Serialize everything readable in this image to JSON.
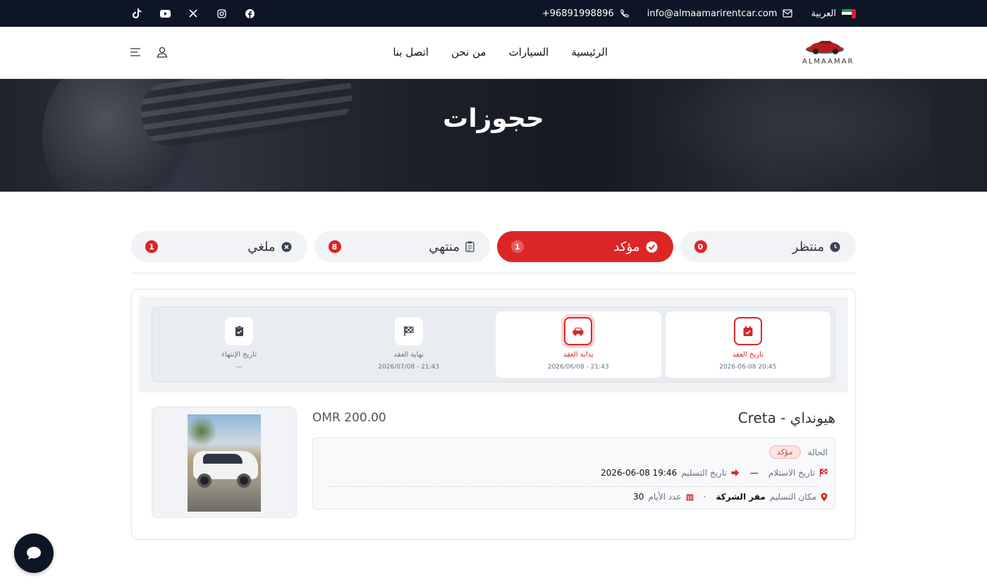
{
  "topbar": {
    "language": "العربية",
    "email": "info@almaamarirentcar.com",
    "phone": "96891998896+",
    "social": [
      "facebook-icon",
      "instagram-icon",
      "x-icon",
      "youtube-icon",
      "tiktok-icon"
    ]
  },
  "nav": {
    "logo_text": "ALMAAMAR",
    "menu": [
      "الرئيسية",
      "السيارات",
      "من نحن",
      "اتصل بنا"
    ]
  },
  "hero": {
    "title": "حجوزات"
  },
  "tabs": [
    {
      "label": "منتظر",
      "count": "0",
      "icon": "clock-icon",
      "active": false
    },
    {
      "label": "مؤكد",
      "count": "1",
      "icon": "check-circle-icon",
      "active": true
    },
    {
      "label": "منتهي",
      "count": "8",
      "icon": "clipboard-icon",
      "active": false
    },
    {
      "label": "ملغي",
      "count": "1",
      "icon": "x-circle-icon",
      "active": false
    }
  ],
  "booking": {
    "timeline": [
      {
        "title": "تاريخ العقد",
        "date": "2026-06-08 20:45"
      },
      {
        "title": "بداية العقد",
        "date": "2026/06/08 - 21:43"
      },
      {
        "title": "نهاية العقد",
        "date": "2026/07/08 - 21:43"
      },
      {
        "title": "تاريخ الإنتهاء",
        "date": "—"
      }
    ],
    "car_title": "هيونداي - Creta",
    "price": "OMR 200.00",
    "status_label": "الحالة",
    "status_value": "مؤكد",
    "pickup_label": "تاريخ الاستلام",
    "pickup_value": "—",
    "delivery_label": "تاريخ التسليم",
    "delivery_value": "2026-06-08 19:46",
    "location_label": "مكان التسليم",
    "location_value": "مقر الشركة",
    "days_label": "عدد الأيام",
    "days_value": "30",
    "dot": "·"
  },
  "colors": {
    "accent": "#dc2626",
    "dark": "#0d1526"
  }
}
